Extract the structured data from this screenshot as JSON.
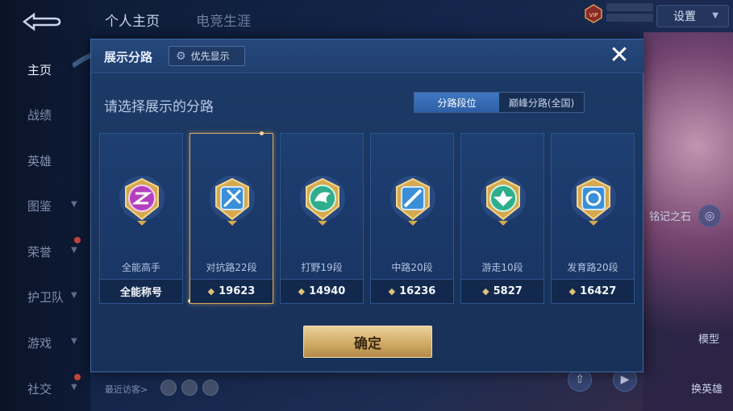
{
  "top": {
    "tab_profile": "个人主页",
    "tab_career": "电竞生涯",
    "settings": "设置",
    "vip": "VIP"
  },
  "sidebar": {
    "items": [
      {
        "label": "主页",
        "active": true
      },
      {
        "label": "战绩",
        "active": false
      },
      {
        "label": "英雄",
        "active": false
      },
      {
        "label": "图鉴",
        "active": false
      },
      {
        "label": "荣誉",
        "active": false
      },
      {
        "label": "护卫队",
        "active": false
      },
      {
        "label": "游戏",
        "active": false
      },
      {
        "label": "社交",
        "active": false
      }
    ]
  },
  "background": {
    "right_label": "铭记之石",
    "model_label": "模型",
    "hero_label": "换英雄",
    "visitors_label": "最近访客>"
  },
  "modal": {
    "title": "展示分路",
    "priority_label": "优先显示",
    "subtitle": "请选择展示的分路",
    "segments": [
      {
        "label": "分路段位",
        "active": true
      },
      {
        "label": "巅峰分路(全国)",
        "active": false
      }
    ],
    "cards": [
      {
        "label": "全能高手",
        "score": "全能称号",
        "has_arrow": false,
        "color": "#b43fbf",
        "selected": false
      },
      {
        "label": "对抗路22段",
        "score": "19623",
        "has_arrow": true,
        "color": "#3a8fd8",
        "selected": true
      },
      {
        "label": "打野19段",
        "score": "14940",
        "has_arrow": true,
        "color": "#2fae8c",
        "selected": false
      },
      {
        "label": "中路20段",
        "score": "16236",
        "has_arrow": true,
        "color": "#3a8fd8",
        "selected": false
      },
      {
        "label": "游走10段",
        "score": "5827",
        "has_arrow": true,
        "color": "#2fae8c",
        "selected": false
      },
      {
        "label": "发育路20段",
        "score": "16427",
        "has_arrow": true,
        "color": "#3a8fd8",
        "selected": false
      }
    ],
    "confirm_label": "确定"
  }
}
